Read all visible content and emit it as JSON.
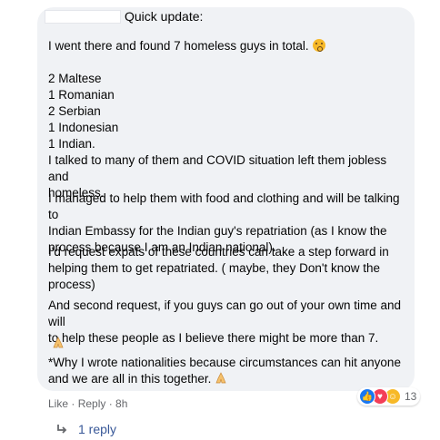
{
  "comment": {
    "header": "Quick update:",
    "paragraphs": [
      "I went there and found 7 homeless guys in total.",
      "2 Maltese\n1 Romanian\n2 Serbian\n1 Indonesian\n1 Indian.",
      "I talked to many of them and COVID situation left them jobless and\nhomeless.",
      "I managed to help them with food and clothing and will be talking to\nIndian Embassy for the Indian guy's repatriation (as I know the\nprocess because I am an Indian national).",
      "I'd request expats of these countries can take a step forward in\nhelping them to get repatriated. ( maybe, they Don't know the\nprocess)",
      "And second request, if you guys can go out of your own time and will\nto help these people as I believe there might be more than 7.",
      "*Why I wrote nationalities because circumstances can hit anyone\nand we are all in this together."
    ]
  },
  "actions": {
    "like": "Like",
    "sep1": " · ",
    "reply": "Reply",
    "sep2": " · ",
    "time": "8h"
  },
  "reactions": {
    "count": "13",
    "types": [
      "like-icon",
      "love-icon",
      "care-icon"
    ]
  },
  "replies": {
    "label": "1 reply"
  },
  "colors": {
    "bubble": "#f0f2f5",
    "link": "#385898",
    "meta": "#65676b"
  }
}
